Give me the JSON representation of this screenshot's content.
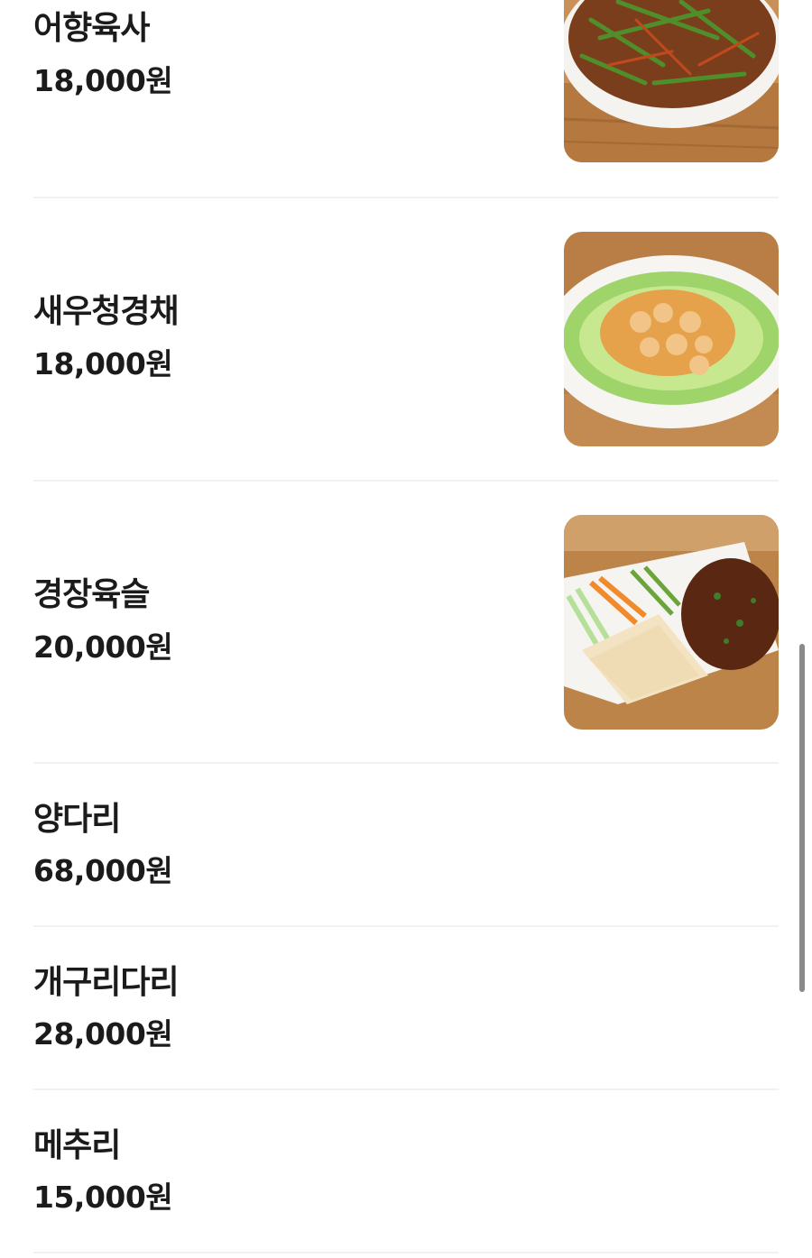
{
  "menu": {
    "items": [
      {
        "name": "어향육사",
        "price": "18,000원",
        "image": "yuxiang-pork-photo"
      },
      {
        "name": "새우청경채",
        "price": "18,000원",
        "image": "shrimp-bokchoy-photo"
      },
      {
        "name": "경장육슬",
        "price": "20,000원",
        "image": "jingjiang-pork-photo"
      },
      {
        "name": "양다리",
        "price": "68,000원"
      },
      {
        "name": "개구리다리",
        "price": "28,000원"
      },
      {
        "name": "메추리",
        "price": "15,000원"
      }
    ]
  },
  "colors": {
    "text": "#1b1b1b",
    "divider": "#f1f1f1",
    "background": "#ffffff",
    "scrollbar": "#8a8a8a"
  }
}
